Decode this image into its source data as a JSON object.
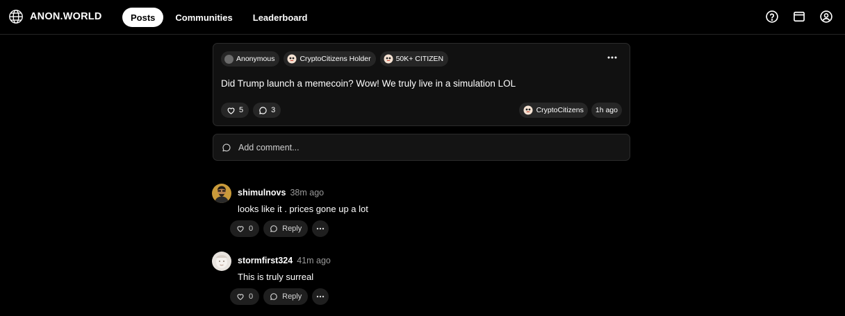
{
  "brand": {
    "name": "ANON.WORLD",
    "icon": "globe-icon"
  },
  "nav": {
    "items": [
      {
        "label": "Posts",
        "active": true
      },
      {
        "label": "Communities",
        "active": false
      },
      {
        "label": "Leaderboard",
        "active": false
      }
    ]
  },
  "top_icons": [
    "help-icon",
    "wallet-icon",
    "account-icon"
  ],
  "post": {
    "badges": [
      {
        "label": "Anonymous",
        "icon": "anonymous-avatar-icon"
      },
      {
        "label": "CryptoCitizens Holder",
        "icon": "cryptocitizen-face-icon"
      },
      {
        "label": "50K+ CITIZEN",
        "icon": "cryptocitizen-face-icon"
      }
    ],
    "text": "Did Trump launch a memecoin? Wow! We truly live in a simulation LOL",
    "likes": "5",
    "comments": "3",
    "community": "CryptoCitizens",
    "time": "1h ago"
  },
  "add_comment": {
    "placeholder": "Add comment..."
  },
  "comments": [
    {
      "user": "shimulnovs",
      "time": "38m ago",
      "text": "looks like it . prices gone up a lot",
      "likes": "0",
      "reply_label": "Reply"
    },
    {
      "user": "stormfirst324",
      "time": "41m ago",
      "text": "This is truly surreal",
      "likes": "0",
      "reply_label": "Reply"
    }
  ],
  "colors": {
    "background": "#000000",
    "card": "#111111",
    "pill": "#262626",
    "active_nav_bg": "#ffffff",
    "muted_text": "#9a9a9a"
  }
}
